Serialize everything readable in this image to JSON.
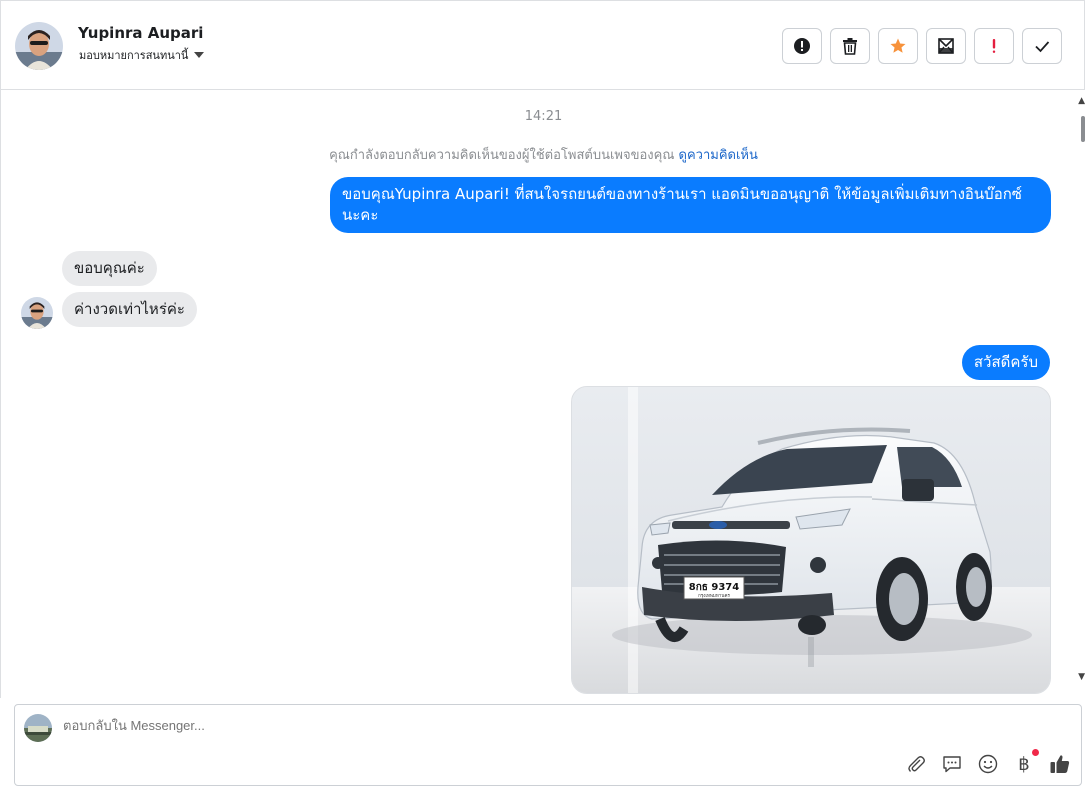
{
  "header": {
    "contact_name": "Yupinra Aupari",
    "assign_label": "มอบหมายการสนทนานี้",
    "actions": [
      {
        "name": "report-icon"
      },
      {
        "name": "trash-icon"
      },
      {
        "name": "star-icon",
        "color": "#f7923b"
      },
      {
        "name": "mark-unread-icon"
      },
      {
        "name": "important-icon",
        "color": "#e41e3f"
      },
      {
        "name": "check-icon"
      }
    ]
  },
  "conversation": {
    "timestamp": "14:21",
    "notice_text": "คุณกำลังตอบกลับความคิดเห็นของผู้ใช้ต่อโพสต์บนเพจของคุณ ",
    "notice_link": "ดูความคิดเห็น",
    "messages": [
      {
        "direction": "out",
        "text": "ขอบคุณYupinra Aupari! ที่สนใจรถยนต์ของทางร้านเรา แอดมินขออนุญาติ ให้ข้อมูลเพิ่มเติมทางอินบ๊อกซ์นะคะ"
      },
      {
        "direction": "in",
        "text": "ขอบคุณค่ะ"
      },
      {
        "direction": "in",
        "text": "ค่างวดเท่าไหร่ค่ะ"
      },
      {
        "direction": "out",
        "text": "สวัสดีครับ"
      },
      {
        "direction": "out",
        "type": "image",
        "plate_text": "8กธ 9374",
        "plate_subtext": "กรุงเทพมหานคร"
      }
    ]
  },
  "composer": {
    "placeholder": "ตอบกลับใน Messenger...",
    "tools": [
      "attachment-icon",
      "saved-reply-icon",
      "emoji-icon",
      "baht-icon",
      "like-icon"
    ],
    "baht_symbol": "฿"
  },
  "colors": {
    "accent": "#0a7cff",
    "incoming_bubble": "#e9eaec",
    "link": "#1b66c9"
  }
}
